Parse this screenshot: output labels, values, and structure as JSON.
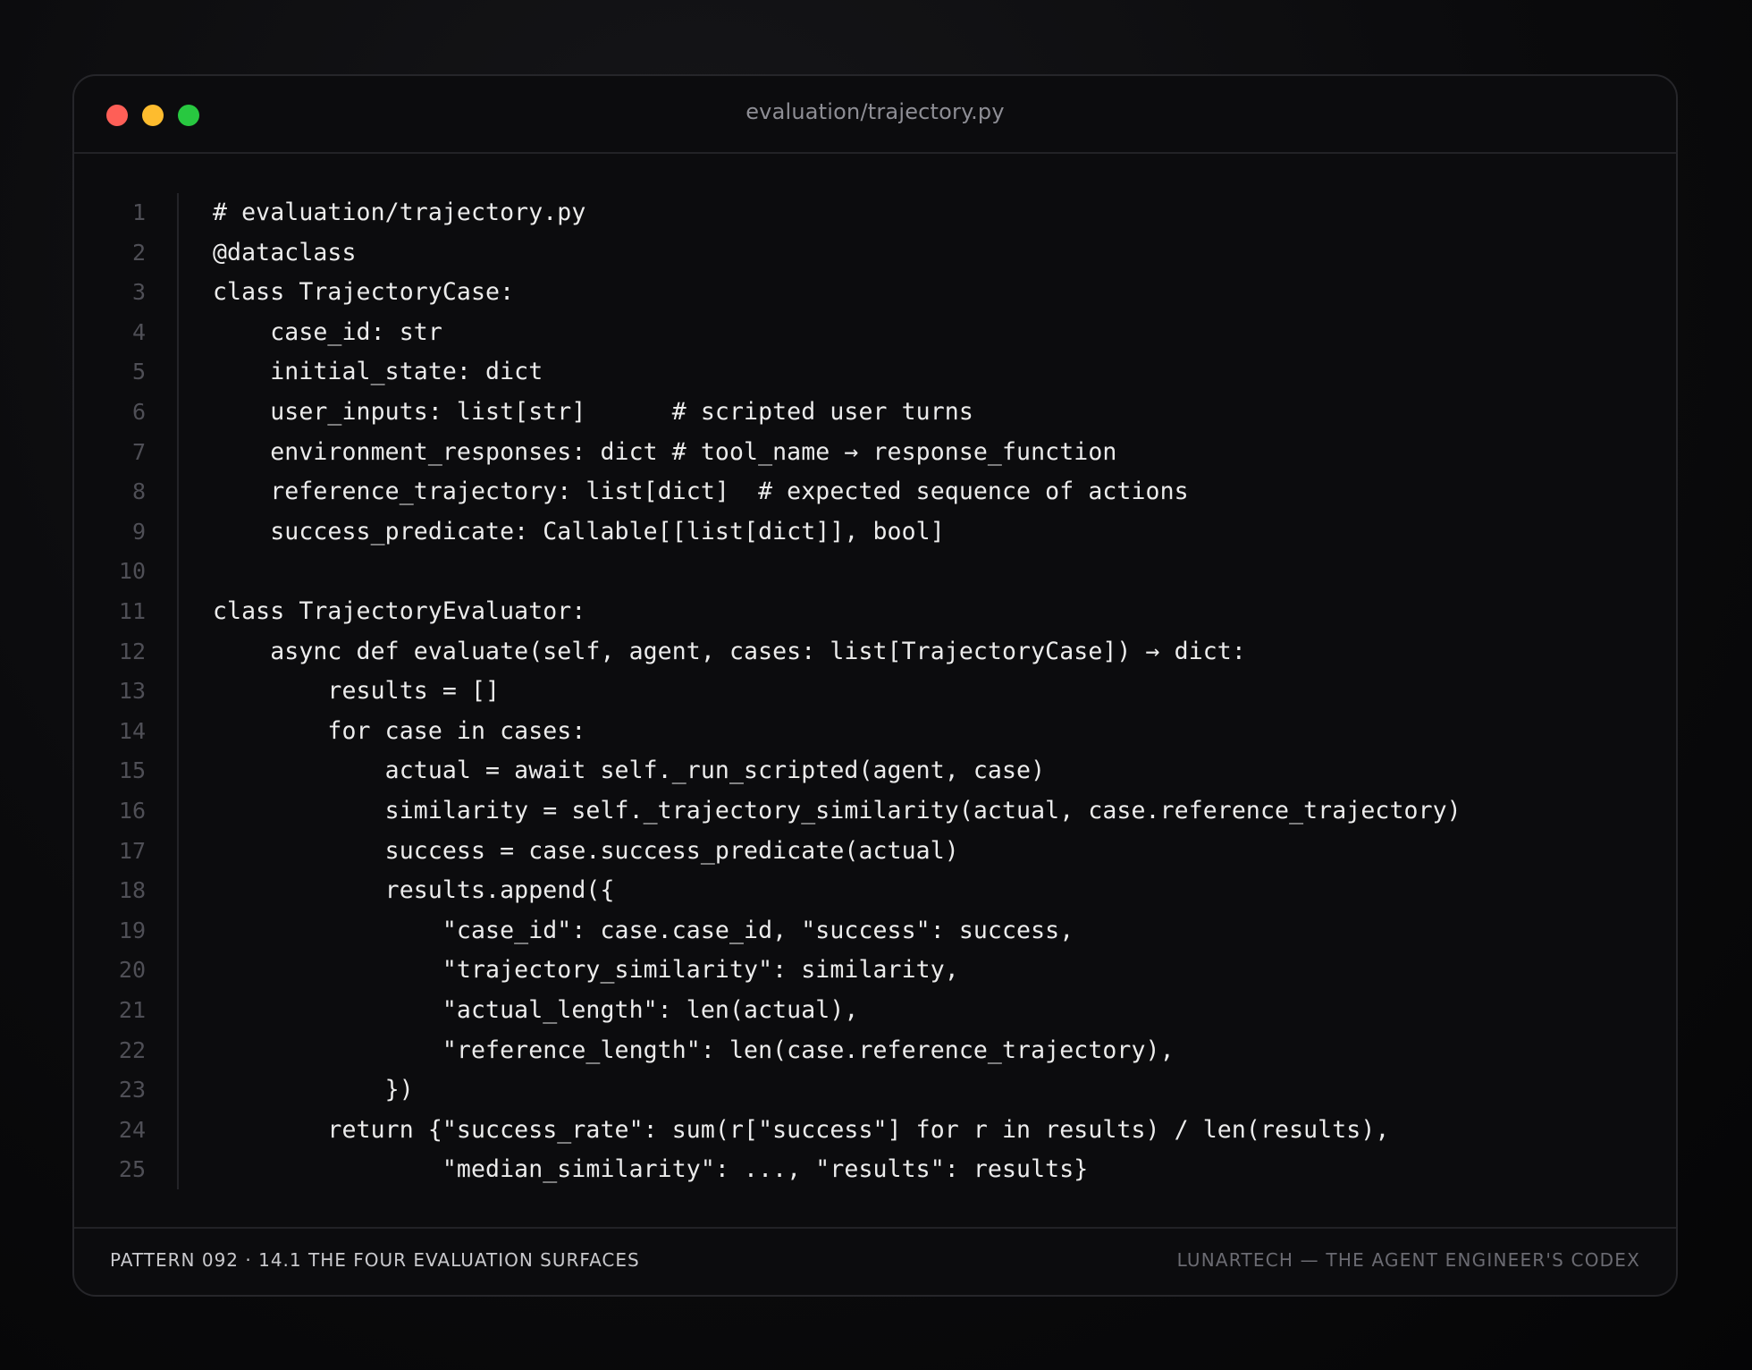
{
  "window": {
    "title": "evaluation/trajectory.py",
    "controls": [
      "close",
      "minimize",
      "maximize"
    ],
    "colors": {
      "close": "#fe5f57",
      "minimize": "#febc2e",
      "maximize": "#28c840",
      "background": "#0c0c0e",
      "code_text": "#ececec",
      "line_number": "#4f4f56"
    }
  },
  "code": {
    "lines": [
      {
        "number": "1",
        "text": "# evaluation/trajectory.py"
      },
      {
        "number": "2",
        "text": "@dataclass"
      },
      {
        "number": "3",
        "text": "class TrajectoryCase:"
      },
      {
        "number": "4",
        "text": "    case_id: str"
      },
      {
        "number": "5",
        "text": "    initial_state: dict"
      },
      {
        "number": "6",
        "text": "    user_inputs: list[str]      # scripted user turns"
      },
      {
        "number": "7",
        "text": "    environment_responses: dict # tool_name → response_function"
      },
      {
        "number": "8",
        "text": "    reference_trajectory: list[dict]  # expected sequence of actions"
      },
      {
        "number": "9",
        "text": "    success_predicate: Callable[[list[dict]], bool]"
      },
      {
        "number": "10",
        "text": ""
      },
      {
        "number": "11",
        "text": "class TrajectoryEvaluator:"
      },
      {
        "number": "12",
        "text": "    async def evaluate(self, agent, cases: list[TrajectoryCase]) → dict:"
      },
      {
        "number": "13",
        "text": "        results = []"
      },
      {
        "number": "14",
        "text": "        for case in cases:"
      },
      {
        "number": "15",
        "text": "            actual = await self._run_scripted(agent, case)"
      },
      {
        "number": "16",
        "text": "            similarity = self._trajectory_similarity(actual, case.reference_trajectory)"
      },
      {
        "number": "17",
        "text": "            success = case.success_predicate(actual)"
      },
      {
        "number": "18",
        "text": "            results.append({"
      },
      {
        "number": "19",
        "text": "                \"case_id\": case.case_id, \"success\": success,"
      },
      {
        "number": "20",
        "text": "                \"trajectory_similarity\": similarity,"
      },
      {
        "number": "21",
        "text": "                \"actual_length\": len(actual),"
      },
      {
        "number": "22",
        "text": "                \"reference_length\": len(case.reference_trajectory),"
      },
      {
        "number": "23",
        "text": "            })"
      },
      {
        "number": "24",
        "text": "        return {\"success_rate\": sum(r[\"success\"] for r in results) / len(results),"
      },
      {
        "number": "25",
        "text": "                \"median_similarity\": ..., \"results\": results}"
      }
    ]
  },
  "footer": {
    "left": "PATTERN 092 · 14.1 THE FOUR EVALUATION SURFACES",
    "right": "LUNARTECH — THE AGENT ENGINEER'S CODEX"
  }
}
